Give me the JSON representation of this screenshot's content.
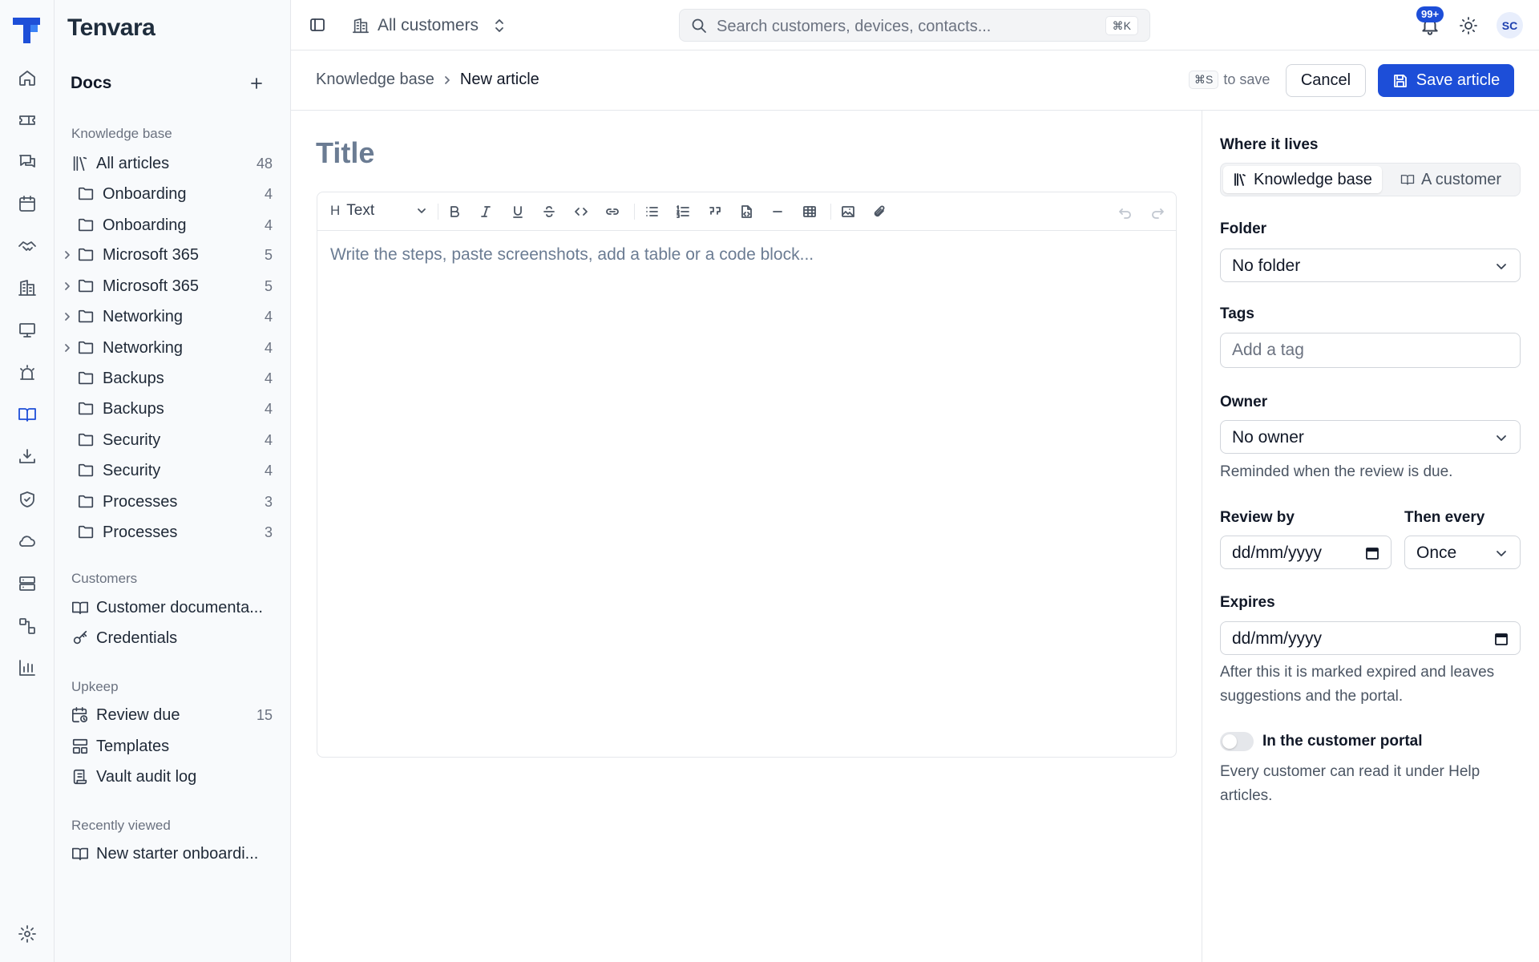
{
  "brand": "Tenvara",
  "nav_rail": {
    "items": [
      {
        "name": "home-icon"
      },
      {
        "name": "ticket-icon"
      },
      {
        "name": "chat-icon"
      },
      {
        "name": "calendar-icon"
      },
      {
        "name": "handshake-icon"
      },
      {
        "name": "building-icon"
      },
      {
        "name": "monitor-icon"
      },
      {
        "name": "alarm-icon"
      },
      {
        "name": "book-icon",
        "active": true
      },
      {
        "name": "download-icon"
      },
      {
        "name": "shield-icon"
      },
      {
        "name": "cloud-icon"
      },
      {
        "name": "server-icon"
      },
      {
        "name": "workflow-icon"
      },
      {
        "name": "chart-icon"
      }
    ],
    "settings": "gear-icon"
  },
  "sidebar": {
    "section_title": "Docs",
    "kb_group": "Knowledge base",
    "kb_items": [
      {
        "label": "All articles",
        "count": "48",
        "icon": "library-icon"
      },
      {
        "label": "Onboarding",
        "count": "4",
        "icon": "folder-icon"
      },
      {
        "label": "Onboarding",
        "count": "4",
        "icon": "folder-icon"
      },
      {
        "label": "Microsoft 365",
        "count": "5",
        "icon": "folder-icon",
        "expandable": true
      },
      {
        "label": "Microsoft 365",
        "count": "5",
        "icon": "folder-icon",
        "expandable": true
      },
      {
        "label": "Networking",
        "count": "4",
        "icon": "folder-icon",
        "expandable": true
      },
      {
        "label": "Networking",
        "count": "4",
        "icon": "folder-icon",
        "expandable": true
      },
      {
        "label": "Backups",
        "count": "4",
        "icon": "folder-icon"
      },
      {
        "label": "Backups",
        "count": "4",
        "icon": "folder-icon"
      },
      {
        "label": "Security",
        "count": "4",
        "icon": "folder-icon"
      },
      {
        "label": "Security",
        "count": "4",
        "icon": "folder-icon"
      },
      {
        "label": "Processes",
        "count": "3",
        "icon": "folder-icon"
      },
      {
        "label": "Processes",
        "count": "3",
        "icon": "folder-icon"
      }
    ],
    "customers_group": "Customers",
    "customer_items": [
      {
        "label": "Customer documenta...",
        "icon": "book-icon"
      },
      {
        "label": "Credentials",
        "icon": "key-icon"
      }
    ],
    "upkeep_group": "Upkeep",
    "upkeep_items": [
      {
        "label": "Review due",
        "count": "15",
        "icon": "calendar-clock-icon"
      },
      {
        "label": "Templates",
        "icon": "template-icon"
      },
      {
        "label": "Vault audit log",
        "icon": "scroll-icon"
      }
    ],
    "recent_group": "Recently viewed",
    "recent_items": [
      {
        "label": "New starter onboardi...",
        "icon": "book-icon"
      }
    ]
  },
  "topbar": {
    "scope_label": "All customers",
    "search_placeholder": "Search customers, devices, contacts...",
    "search_shortcut": "⌘K",
    "notifications_badge": "99+",
    "avatar_initials": "SC"
  },
  "header": {
    "breadcrumb_parent": "Knowledge base",
    "breadcrumb_current": "New article",
    "save_hint_key": "⌘S",
    "save_hint_text": "to save",
    "cancel_label": "Cancel",
    "save_label": "Save article"
  },
  "editor": {
    "title_placeholder": "Title",
    "text_style": "Text",
    "body_placeholder": "Write the steps, paste screenshots, add a table or a code block..."
  },
  "props": {
    "where_label": "Where it lives",
    "where_options": [
      "Knowledge base",
      "A customer"
    ],
    "where_selected": "Knowledge base",
    "folder_label": "Folder",
    "folder_value": "No folder",
    "tags_label": "Tags",
    "tags_placeholder": "Add a tag",
    "owner_label": "Owner",
    "owner_value": "No owner",
    "owner_help": "Reminded when the review is due.",
    "review_label": "Review by",
    "review_value": "dd/mm/yyyy",
    "then_label": "Then every",
    "then_value": "Once",
    "expires_label": "Expires",
    "expires_value": "dd/mm/yyyy",
    "expires_help": "After this it is marked expired and leaves suggestions and the portal.",
    "portal_label": "In the customer portal",
    "portal_enabled": false,
    "portal_help": "Every customer can read it under Help articles."
  },
  "colors": {
    "accent": "#1d4ed8",
    "brand_logo": "#1e4fd8"
  }
}
